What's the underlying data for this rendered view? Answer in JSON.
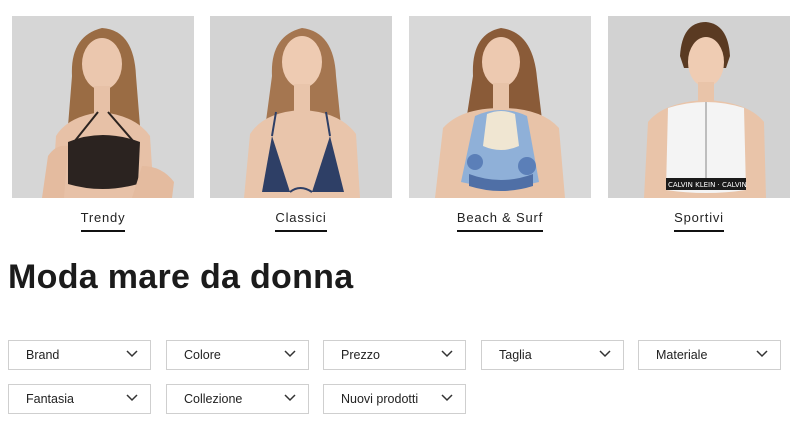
{
  "categories": [
    {
      "label": "Trendy",
      "swimsuit": "black-halter-top-icon",
      "top_color": "#2b2320"
    },
    {
      "label": "Classici",
      "swimsuit": "navy-triangle-top-icon",
      "top_color": "#2e3f66"
    },
    {
      "label": "Beach & Surf",
      "swimsuit": "floral-crochet-top-icon",
      "top_color": "#8fb0d8"
    },
    {
      "label": "Sportivi",
      "swimsuit": "white-zip-crop-top-icon",
      "top_color": "#f4f4f4"
    }
  ],
  "page": {
    "title": "Moda mare da donna"
  },
  "filters": [
    {
      "label": "Brand"
    },
    {
      "label": "Colore"
    },
    {
      "label": "Prezzo"
    },
    {
      "label": "Taglia"
    },
    {
      "label": "Materiale"
    },
    {
      "label": "Fantasia"
    },
    {
      "label": "Collezione"
    },
    {
      "label": "Nuovi prodotti"
    }
  ],
  "colors": {
    "photo_bg": "#d5d5d5",
    "skin": "#e7c1a7",
    "hair_light": "#9a6c44",
    "hair_dark": "#5a3a22",
    "text": "#1b1b1b",
    "border": "#cfcfcf"
  }
}
